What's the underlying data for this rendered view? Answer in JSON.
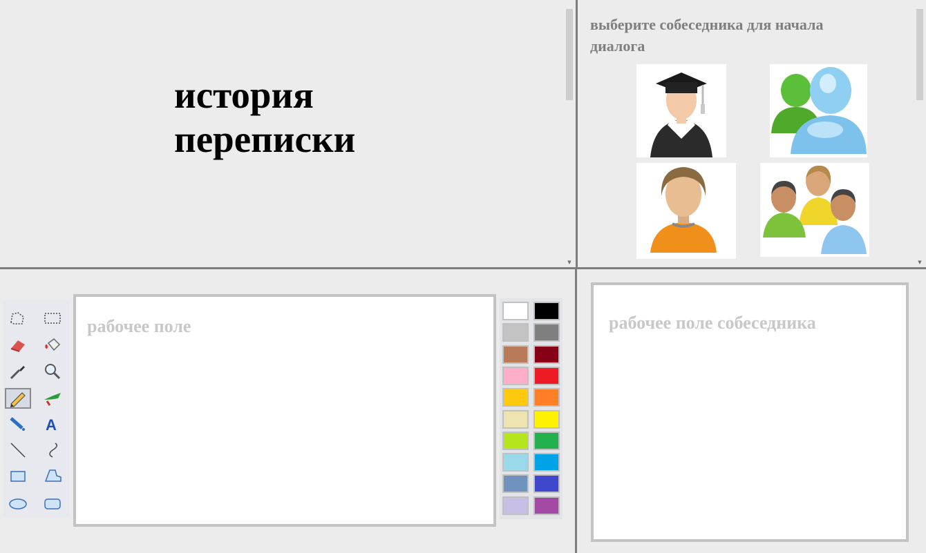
{
  "history": {
    "title_line1": "история",
    "title_line2": "переписки"
  },
  "contacts": {
    "prompt": "выберите собеседника для начала диалога",
    "avatars": [
      {
        "name": "graduate-avatar-icon"
      },
      {
        "name": "users-messenger-avatar-icon"
      },
      {
        "name": "person-avatar-icon"
      },
      {
        "name": "group-avatar-icon"
      }
    ]
  },
  "workspace": {
    "placeholder": "рабочее поле"
  },
  "partner_workspace": {
    "placeholder": "рабочее поле собеседника"
  },
  "tools": [
    "free-form-select-icon",
    "rect-select-icon",
    "eraser-icon",
    "fill-bucket-icon",
    "color-picker-icon",
    "magnifier-icon",
    "pencil-icon",
    "brush-icon",
    "airbrush-icon",
    "text-tool-icon",
    "line-tool-icon",
    "curve-tool-icon",
    "rectangle-tool-icon",
    "polygon-tool-icon",
    "ellipse-tool-icon",
    "rounded-rect-tool-icon"
  ],
  "active_tool": "pencil-icon",
  "palette": [
    "#ffffff",
    "#000000",
    "#c3c3c3",
    "#7f7f7f",
    "#b97a57",
    "#880015",
    "#ffaec9",
    "#ed1c24",
    "#ffc90e",
    "#ff7f27",
    "#efe4b0",
    "#fff200",
    "#b5e61d",
    "#22b14c",
    "#99d9ea",
    "#00a2e8",
    "#7092be",
    "#3f48cc",
    "#c8bfe7",
    "#a349a4"
  ]
}
